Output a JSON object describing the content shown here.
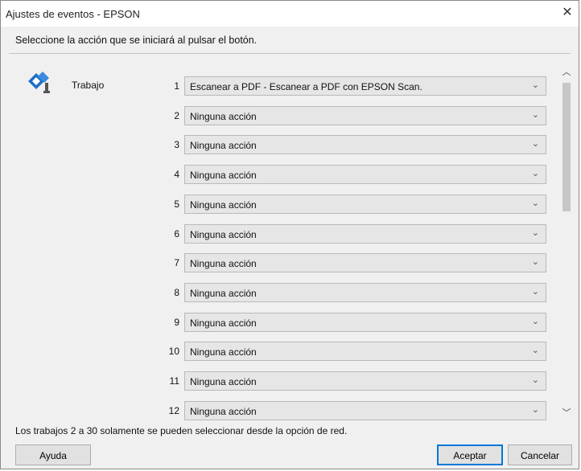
{
  "window": {
    "title": "Ajustes de eventos - EPSON",
    "close_glyph": "✕"
  },
  "instruction": "Seleccione la acción que se iniciará al pulsar el botón.",
  "job": {
    "icon": "scanner-job-icon",
    "label": "Trabajo"
  },
  "rows": [
    {
      "number": "1",
      "value": "Escanear a PDF - Escanear a PDF con EPSON Scan."
    },
    {
      "number": "2",
      "value": "Ninguna acción"
    },
    {
      "number": "3",
      "value": "Ninguna acción"
    },
    {
      "number": "4",
      "value": "Ninguna acción"
    },
    {
      "number": "5",
      "value": "Ninguna acción"
    },
    {
      "number": "6",
      "value": "Ninguna acción"
    },
    {
      "number": "7",
      "value": "Ninguna acción"
    },
    {
      "number": "8",
      "value": "Ninguna acción"
    },
    {
      "number": "9",
      "value": "Ninguna acción"
    },
    {
      "number": "10",
      "value": "Ninguna acción"
    },
    {
      "number": "11",
      "value": "Ninguna acción"
    },
    {
      "number": "12",
      "value": "Ninguna acción"
    }
  ],
  "note": "Los trabajos 2 a 30 solamente se pueden seleccionar desde la opción de red.",
  "buttons": {
    "help": "Ayuda",
    "ok": "Aceptar",
    "cancel": "Cancelar"
  },
  "colors": {
    "focus_border": "#0078d7"
  }
}
